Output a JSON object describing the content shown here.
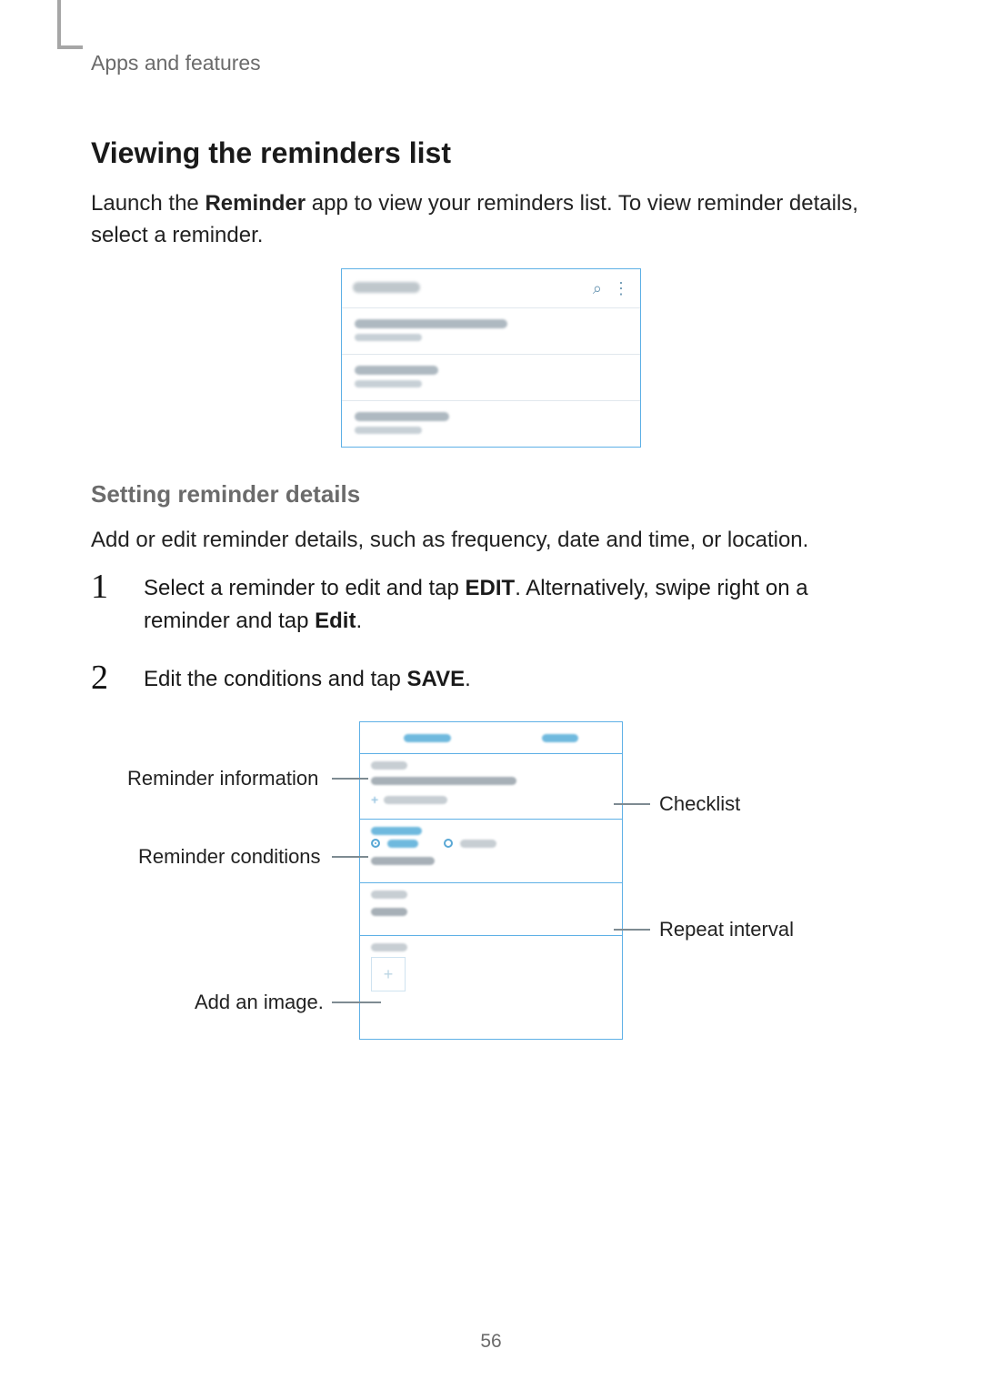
{
  "header": {
    "running": "Apps and features"
  },
  "page": {
    "number": "56"
  },
  "section": {
    "heading": "Viewing the reminders list",
    "intro_pre": "Launch the ",
    "intro_bold": "Reminder",
    "intro_post": " app to view your reminders list. To view reminder details, select a reminder.",
    "sub_heading": "Setting reminder details",
    "sub_intro": "Add or edit reminder details, such as frequency, date and time, or location."
  },
  "steps": {
    "s1_a": "Select a reminder to edit and tap ",
    "s1_b": "EDIT",
    "s1_c": ". Alternatively, swipe right on a reminder and tap ",
    "s1_d": "Edit",
    "s1_e": ".",
    "s2_a": "Edit the conditions and tap ",
    "s2_b": "SAVE",
    "s2_c": "."
  },
  "callouts": {
    "info": "Reminder information",
    "cond": "Reminder conditions",
    "addimg": "Add an image.",
    "checklist": "Checklist",
    "repeat": "Repeat interval"
  },
  "icons": {
    "search": "⌕",
    "more": "⋮",
    "plus": "+"
  }
}
